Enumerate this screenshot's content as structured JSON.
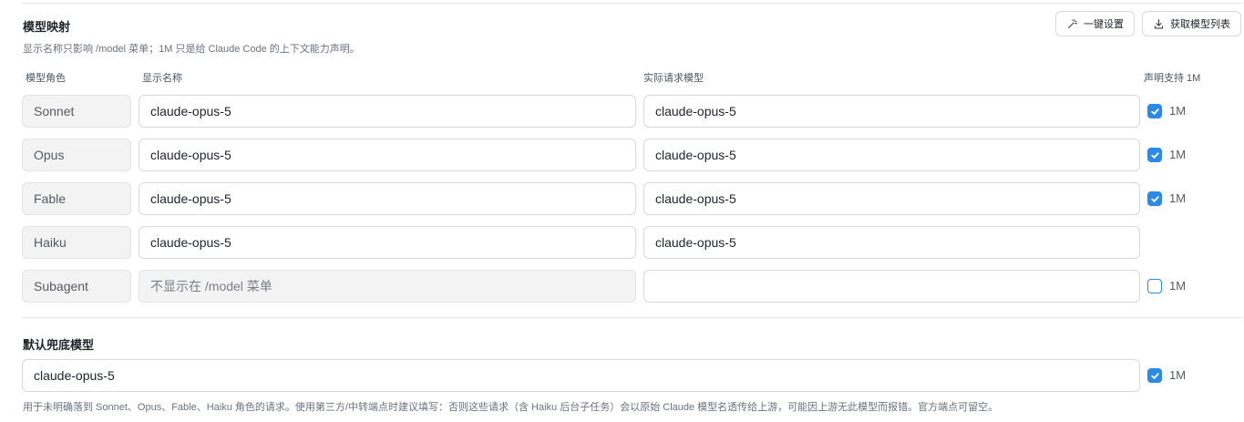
{
  "header": {
    "title": "模型映射",
    "description": "显示名称只影响 /model 菜单；1M 只是给 Claude Code 的上下文能力声明。",
    "one_click_label": "一键设置",
    "fetch_label": "获取模型列表"
  },
  "columns": {
    "role": "模型角色",
    "display": "显示名称",
    "request": "实际请求模型",
    "support": "声明支持 1M"
  },
  "rows": [
    {
      "role": "Sonnet",
      "display": "claude-opus-5",
      "request": "claude-opus-5",
      "checkbox": true,
      "checked": true,
      "label": "1M"
    },
    {
      "role": "Opus",
      "display": "claude-opus-5",
      "request": "claude-opus-5",
      "checkbox": true,
      "checked": true,
      "label": "1M"
    },
    {
      "role": "Fable",
      "display": "claude-opus-5",
      "request": "claude-opus-5",
      "checkbox": true,
      "checked": true,
      "label": "1M"
    },
    {
      "role": "Haiku",
      "display": "claude-opus-5",
      "request": "claude-opus-5",
      "checkbox": false,
      "checked": false,
      "label": ""
    },
    {
      "role": "Subagent",
      "display": "",
      "display_placeholder": "不显示在 /model 菜单",
      "request": "",
      "checkbox": true,
      "checked": false,
      "label": "1M"
    }
  ],
  "fallback": {
    "title": "默认兜底模型",
    "value": "claude-opus-5",
    "checked": true,
    "label": "1M",
    "note": "用于未明确落到 Sonnet、Opus、Fable、Haiku 角色的请求。使用第三方/中转端点时建议填写：否则这些请求（含 Haiku 后台子任务）会以原始 Claude 模型名透传给上游，可能因上游无此模型而报错。官方端点可留空。"
  },
  "colors": {
    "accent": "#2b8ae6"
  }
}
